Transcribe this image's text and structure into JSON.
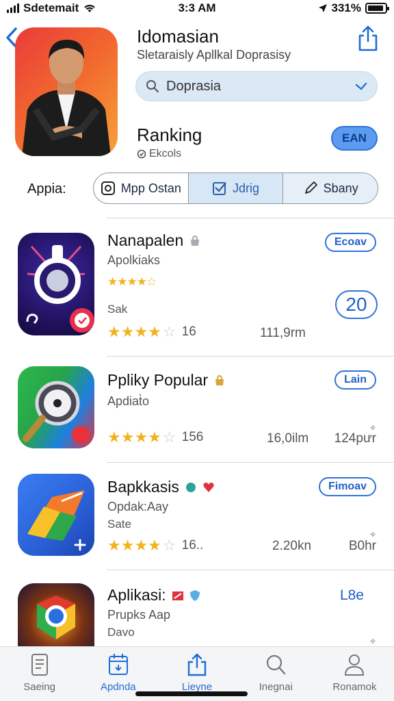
{
  "status_bar": {
    "carrier": "Sdetemait",
    "time": "3:3 AM",
    "battery": "331%",
    "battery_level": 0.9
  },
  "header": {
    "app_name": "Idomasian",
    "subtitle": "Sletaraisly Apllkal Doprasisy",
    "search_value": "Doprasia",
    "ranking_label": "Ranking",
    "ranking_sub": "Ekcols",
    "earn_label": "EAN"
  },
  "filter": {
    "label": "Appia:",
    "segments": [
      {
        "label": "Mpp Ostan",
        "icon": "app-icon"
      },
      {
        "label": "Jdrig",
        "icon": "checkbox-icon"
      },
      {
        "label": "Sbany",
        "icon": "pencil-icon"
      }
    ]
  },
  "list": [
    {
      "title": "Nanapalen",
      "category": "Apolkiaks",
      "small_rating": 4.5,
      "secondary": "Sak",
      "rating": 3.5,
      "count": "16",
      "size": "111,9rm",
      "button": "Ecoav",
      "rank": "20",
      "icon": "camera-lens-icon"
    },
    {
      "title": "Ppliky Popular",
      "category": "Apdiat̀o",
      "rating": 3.5,
      "count": "156",
      "size": "16,0ilm",
      "extra": "124pưr",
      "button": "Lain",
      "icon": "magnifier-icon"
    },
    {
      "title": "Bapkkasis",
      "category": "Opdak:Aay",
      "secondary": "Sate",
      "rating": 3.5,
      "count": "16..",
      "size": "2.20kn",
      "extra": "B0hr",
      "button": "Fimoav",
      "icon": "folder-arrow-icon"
    },
    {
      "title": "Aplikasi:",
      "category": "Prupks Aap",
      "secondary": "Davo",
      "button": "L8e",
      "icon": "chrome-icon"
    }
  ],
  "tabs": [
    {
      "label": "Saeing",
      "icon": "document-icon",
      "active": false
    },
    {
      "label": "Apdnda",
      "icon": "calendar-icon",
      "active": true
    },
    {
      "label": "Lieyne",
      "icon": "share-icon",
      "active": true
    },
    {
      "label": "Inegnai",
      "icon": "search-icon",
      "active": false
    },
    {
      "label": "Ronamok",
      "icon": "person-icon",
      "active": false
    }
  ],
  "colors": {
    "accent": "#1f6bd4",
    "star": "#f2b21f",
    "hero_start": "#e93b3b",
    "hero_end": "#f7a23a"
  }
}
